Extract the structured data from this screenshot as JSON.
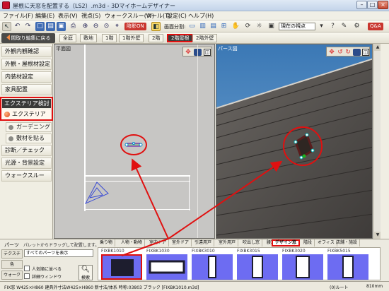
{
  "app": {
    "title": "屋根に天窓を配置する（LS2）.m3d - 3Dマイホームデザイナー"
  },
  "menu": {
    "items": [
      "ファイル(F)",
      "編集(E)",
      "表示(V)",
      "視点(S)",
      "ウォークスルー(W)",
      "ツール(T)",
      "設定(C)",
      "ヘルプ(H)"
    ]
  },
  "toolbar": {
    "shadow_on_label": "陰影ON",
    "screen_split_label": "画面分割:",
    "viewpoint_select": "現在の視点",
    "qa_label": "Q&A"
  },
  "subtoolbar": {
    "back_label": "間取り編集に戻る",
    "floor_tabs": [
      "全庭",
      "敷地",
      "1階",
      "1階外壁",
      "2階",
      "2階屋根",
      "2階外壁"
    ],
    "active_floor": "2階屋根"
  },
  "sidebar": {
    "items": [
      "外観内観確認",
      "外観・屋根材設定",
      "内装材設定",
      "家具配置"
    ],
    "group_header": "エクステリア検討",
    "selected": "エクステリア",
    "sub_items": [
      "ガーデニング",
      "敷材を貼る"
    ],
    "items_after": [
      "診断／チェック",
      "光源・背景設定",
      "ウォークスルー"
    ]
  },
  "plan_view": {
    "label": "平面図"
  },
  "persp_view": {
    "label": "パース図"
  },
  "parts": {
    "label": "パーツ",
    "hint": "パレットからドラッグして配置します。",
    "side_buttons": [
      "テクスチャ",
      "色",
      "ウォーク"
    ],
    "category_select": "すべてのパーツを表示",
    "checks": [
      "人気順に並べる",
      "詳細ウィンドウ"
    ],
    "search_label": "検索",
    "tabs": [
      "乗り物",
      "人物・動物",
      "室内ドア",
      "室外ドア",
      "引違用戸",
      "室外用戸",
      "吹出し窓",
      "腰窓",
      "デザイン窓",
      "階段",
      "オフィス",
      "店舗・施設"
    ],
    "active_tab": "デザイン窓",
    "thumbs": [
      "FIXBK1010",
      "FIXBK1030",
      "FIXBK3010",
      "FIXBK3015",
      "FIXBK3020",
      "FIXBK5015"
    ]
  },
  "status": {
    "text": "FIX窓 W425×H860  建具外寸法W425×H860 新寸法/体系 時称:03803 ブラック  [FIXBK1010.m3d]",
    "floor": "(0)ルート",
    "scale": "810mm"
  },
  "colors": {
    "highlight": "#e01010",
    "dark_tab": "#3d3d3b",
    "thumb_bg": "#6d6cf2",
    "sky": "#4d8bc6",
    "roof": "#5a5552"
  }
}
